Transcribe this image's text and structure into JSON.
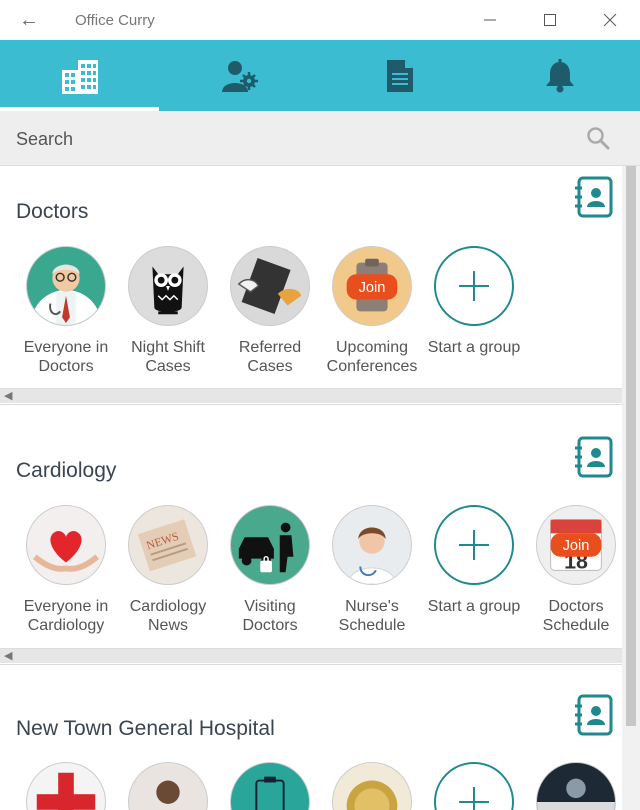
{
  "window": {
    "title": "Office Curry",
    "back_glyph": "←",
    "minimize_glyph": "—",
    "close_glyph": "✕"
  },
  "nav": {
    "tabs": [
      {
        "icon": "building-icon",
        "active": true
      },
      {
        "icon": "user-settings-icon",
        "active": false
      },
      {
        "icon": "document-icon",
        "active": false
      },
      {
        "icon": "bell-icon",
        "active": false
      }
    ]
  },
  "search": {
    "placeholder": "Search"
  },
  "sections": [
    {
      "title": "Doctors",
      "groups": [
        {
          "label": "Everyone in Doctors",
          "icon": "doctor-avatar-icon"
        },
        {
          "label": "Night Shift Cases",
          "icon": "owl-icon"
        },
        {
          "label": "Referred Cases",
          "icon": "handoff-icon"
        },
        {
          "label": "Upcoming Conferences",
          "icon": "join-badge-icon",
          "badge": "Join"
        },
        {
          "label": "Start a group",
          "icon": "plus-icon"
        }
      ]
    },
    {
      "title": "Cardiology",
      "groups": [
        {
          "label": "Everyone in Cardiology",
          "icon": "heart-hands-icon"
        },
        {
          "label": "Cardiology News",
          "icon": "newspaper-icon",
          "badge": "NEWS"
        },
        {
          "label": "Visiting Doctors",
          "icon": "car-visitor-icon"
        },
        {
          "label": "Nurse's Schedule",
          "icon": "nurse-avatar-icon"
        },
        {
          "label": "Start a group",
          "icon": "plus-icon"
        },
        {
          "label": "Doctors Schedule",
          "icon": "calendar-join-icon",
          "badge": "Join"
        }
      ]
    },
    {
      "title": "New Town General Hospital",
      "groups": [
        {
          "label": "",
          "icon": "medical-cross-icon"
        },
        {
          "label": "",
          "icon": "person-avatar-icon"
        },
        {
          "label": "",
          "icon": "clipboard-icon"
        },
        {
          "label": "",
          "icon": "gold-medal-icon"
        },
        {
          "label": "",
          "icon": "plus-icon"
        },
        {
          "label": "",
          "icon": "photo-icon"
        }
      ]
    }
  ],
  "colors": {
    "accent": "#3bbcd1",
    "teal": "#1e8a8f",
    "join_orange": "#e84f1d"
  }
}
